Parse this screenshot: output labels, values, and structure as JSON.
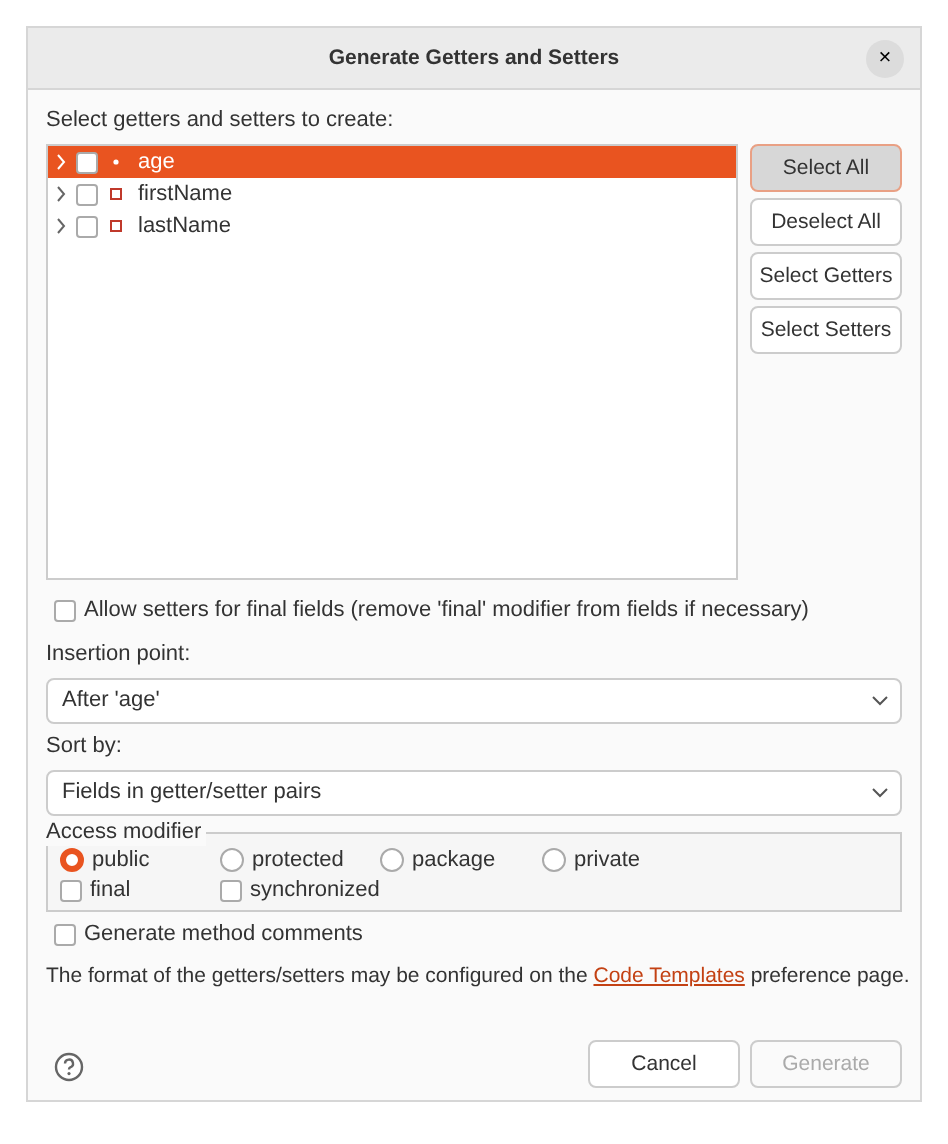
{
  "window": {
    "title": "Generate Getters and Setters",
    "close": "×"
  },
  "tree": {
    "prompt": "Select getters and setters to create:",
    "items": [
      {
        "label": "age",
        "checked": false,
        "selected": true,
        "expanded": false
      },
      {
        "label": "firstName",
        "checked": false,
        "selected": false,
        "expanded": false
      },
      {
        "label": "lastName",
        "checked": false,
        "selected": false,
        "expanded": false
      }
    ]
  },
  "side_buttons": [
    {
      "label": "Select All",
      "focused": true
    },
    {
      "label": "Deselect All",
      "focused": false
    },
    {
      "label": "Select Getters",
      "focused": false
    },
    {
      "label": "Select Setters",
      "focused": false
    }
  ],
  "allow_final": {
    "label": "Allow setters for final fields (remove 'final' modifier from fields if necessary)",
    "checked": false
  },
  "insertion": {
    "label": "Insertion point:",
    "value": "After 'age'"
  },
  "sort": {
    "label": "Sort by:",
    "value": "Fields in getter/setter pairs"
  },
  "access": {
    "legend": "Access modifier",
    "modifiers": [
      {
        "label": "public",
        "selected": true
      },
      {
        "label": "protected",
        "selected": false
      },
      {
        "label": "package",
        "selected": false
      },
      {
        "label": "private",
        "selected": false
      }
    ],
    "options": [
      {
        "label": "final",
        "checked": false
      },
      {
        "label": "synchronized",
        "checked": false
      }
    ]
  },
  "comments": {
    "label": "Generate method comments",
    "checked": false
  },
  "note": {
    "before": "The format of the getters/setters may be configured on the",
    "link": "Code Templates",
    "after": "preference page."
  },
  "footer": {
    "buttons": [
      {
        "label": "Cancel",
        "disabled": false
      },
      {
        "label": "Generate",
        "disabled": true
      }
    ]
  }
}
